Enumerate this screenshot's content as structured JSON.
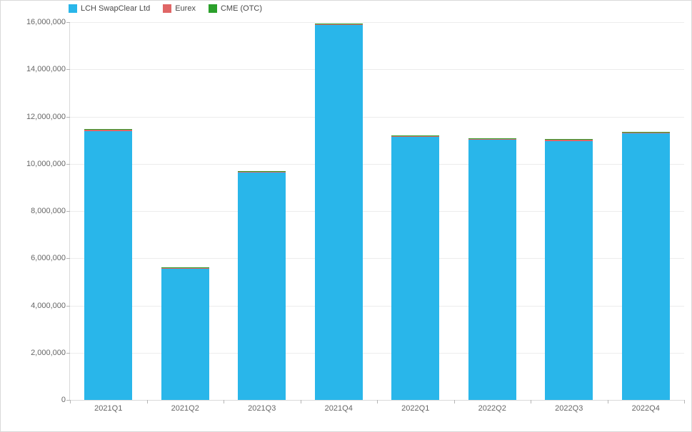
{
  "legend": [
    {
      "name": "LCH SwapClear Ltd",
      "color": "#29B6EA"
    },
    {
      "name": "Eurex",
      "color": "#E06666"
    },
    {
      "name": "CME (OTC)",
      "color": "#2BA02B"
    }
  ],
  "chart_data": {
    "type": "bar",
    "stacked": true,
    "categories": [
      "2021Q1",
      "2021Q2",
      "2021Q3",
      "2021Q4",
      "2022Q1",
      "2022Q2",
      "2022Q3",
      "2022Q4"
    ],
    "series": [
      {
        "name": "LCH SwapClear Ltd",
        "color": "#29B6EA",
        "values": [
          11380000,
          5550000,
          9620000,
          15870000,
          11130000,
          11010000,
          10960000,
          11280000
        ]
      },
      {
        "name": "Eurex",
        "color": "#E06666",
        "values": [
          50000,
          30000,
          50000,
          50000,
          50000,
          50000,
          50000,
          50000
        ]
      },
      {
        "name": "CME (OTC)",
        "color": "#2BA02B",
        "values": [
          10000,
          10000,
          10000,
          10000,
          10000,
          10000,
          10000,
          10000
        ]
      }
    ],
    "ylim": [
      0,
      16000000
    ],
    "yticks": [
      0,
      2000000,
      4000000,
      6000000,
      8000000,
      10000000,
      12000000,
      14000000,
      16000000
    ],
    "ytick_labels": [
      "0",
      "2,000,000",
      "4,000,000",
      "6,000,000",
      "8,000,000",
      "10,000,000",
      "12,000,000",
      "14,000,000",
      "16,000,000"
    ],
    "xlabel": "",
    "ylabel": "",
    "title": ""
  }
}
